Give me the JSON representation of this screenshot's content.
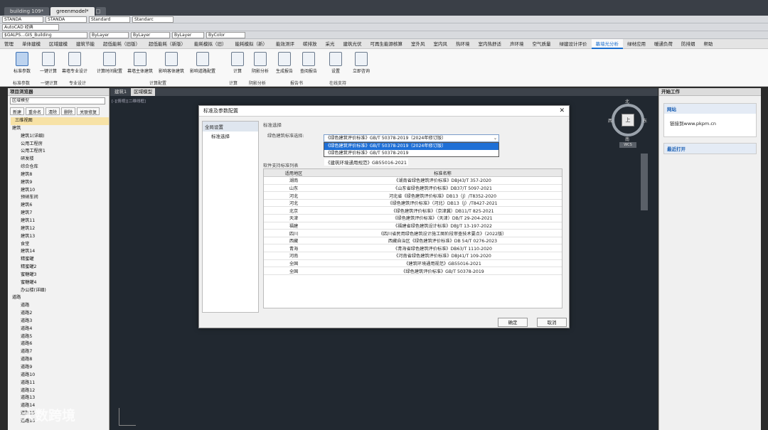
{
  "doc_tabs": [
    "building 109*",
    "greenmodel*"
  ],
  "toolbar1": {
    "combo1": "STANDA",
    "combo2": "STANDA",
    "combo3": "Standard",
    "combo4": "Standarc"
  },
  "toolbar2": {
    "workspace": "AutoCAD 经典"
  },
  "toolbar3": {
    "layer": "$GALPS...GIS_Building",
    "color": "ByLayer",
    "linetype": "ByLayer",
    "lineweight": "ByLayer",
    "plotstyle": "ByColor"
  },
  "menu_tabs": [
    "管理",
    "单体建模",
    "区域建模",
    "建筑节能",
    "超低能耗（旧版）",
    "超低能耗（新版）",
    "能耗模拟（旧）",
    "能耗模拟（新）",
    "能效测评",
    "碳排放",
    "采光",
    "建筑光伏",
    "可再生能源核算",
    "室外风",
    "室内风",
    "热环境",
    "室内热舒适",
    "声环境",
    "空气质量",
    "绿建设计评价",
    "幕墙光分析",
    "绿材应用",
    "暖通负荷",
    "防排烟",
    "帮助"
  ],
  "ribbon": {
    "buttons": [
      "标准参数",
      "一键计算",
      "幕墙专业设计",
      "计算时间配置",
      "幕墙主体建筑",
      "影响客体建筑",
      "影响道路配置",
      "计算",
      "阴影分析",
      "生成报告",
      "查阅报告",
      "设置",
      "立即咨询"
    ],
    "groups": [
      "标准参数",
      "一键计算",
      "专业设计",
      "计算配置",
      "计算",
      "阴影分析",
      "报告书",
      "在线支持"
    ]
  },
  "left_panel": {
    "title": "项目浏览器",
    "dropdown": "区域模型",
    "actions": [
      "新建",
      "重命名",
      "清除",
      "删除",
      "关联修复"
    ],
    "tree": [
      "三维视图",
      "建筑",
      "建筑1(详细)",
      "公用工程房",
      "公用工程房1",
      "研发楼",
      "综合仓库",
      "建筑8",
      "建筑9",
      "建筑10",
      "预硝车间",
      "建筑6",
      "建筑7",
      "建筑11",
      "建筑12",
      "建筑13",
      "食堂",
      "建筑14",
      "精蜜罐",
      "精蜜罐2",
      "蜜糖罐3",
      "蜜糖罐4",
      "办公楼(详细)",
      "道路",
      "道路",
      "道路2",
      "道路3",
      "道路4",
      "道路5",
      "道路6",
      "道路7",
      "道路8",
      "道路9",
      "道路10",
      "道路11",
      "道路12",
      "道路13",
      "道路14",
      "道路15",
      "道路16"
    ]
  },
  "canvas": {
    "tabs": [
      "建筑1",
      "区域模型"
    ],
    "viewport_label": "[-][俯视][二维线框]",
    "compass": {
      "n": "北",
      "s": "南",
      "e": "东",
      "w": "西",
      "center": "上"
    },
    "wcs": "WCS"
  },
  "right_panel": {
    "title": "开始工作",
    "website_section": "网站",
    "website_link": "链接到www.pkpm.cn",
    "recent_section": "最近打开"
  },
  "dialog": {
    "title": "标准及参数配置",
    "nav": [
      "全局设置",
      "标准选择"
    ],
    "section": "标准选择",
    "select_label": "绿色建筑标准选择:",
    "select_value": "《绿色建筑评价标准》GB/T 50378-2019（2024年修订版）",
    "options": [
      "《绿色建筑评价标准》GB/T 50378-2019（2024年修订版）",
      "《绿色建筑评价标准》GB/T 50378-2019"
    ],
    "floating_label": "《建筑环境通用规范》GB55016-2021",
    "list_label": "软件支持标准列表",
    "columns": [
      "适用地区",
      "标准名称"
    ],
    "rows": [
      [
        "湖南",
        "《湖南省绿色建筑评价标准》DBJ43/T 357-2020"
      ],
      [
        "山东",
        "《山东省绿色建筑评价标准》DB37/T 5097-2021"
      ],
      [
        "河北",
        "河北省《绿色建筑评价标准》DB13（J）/T8352-2020"
      ],
      [
        "河北",
        "《绿色建筑评价标准》（河北）DB13（J）/T8427-2021"
      ],
      [
        "北京",
        "《绿色建筑评价标准》（京津冀）DB11/T 825-2021"
      ],
      [
        "天津",
        "《绿色建筑评价标准》（天津）DB/T 29-204-2021"
      ],
      [
        "福建",
        "《福建省绿色建筑设计标准》DBJ/T 13-197-2022"
      ],
      [
        "四川",
        "《四川省民用绿色建筑设计施工图阶段审查技术要点》（2022版）"
      ],
      [
        "西藏",
        "西藏自治区《绿色建筑评价标准》DB 54/T 0276-2023"
      ],
      [
        "青海",
        "《青海省绿色建筑评价标准》DB63/T 1110-2020"
      ],
      [
        "河南",
        "《河南省绿色建筑评价标准》DBJ41/T 109-2020"
      ],
      [
        "全国",
        "《建筑环境通用规范》GB55016-2021"
      ],
      [
        "全国",
        "《绿色建筑评价标准》GB/T 50378-2019"
      ]
    ],
    "ok": "确定",
    "cancel": "取消"
  },
  "watermark": "大数跨境"
}
